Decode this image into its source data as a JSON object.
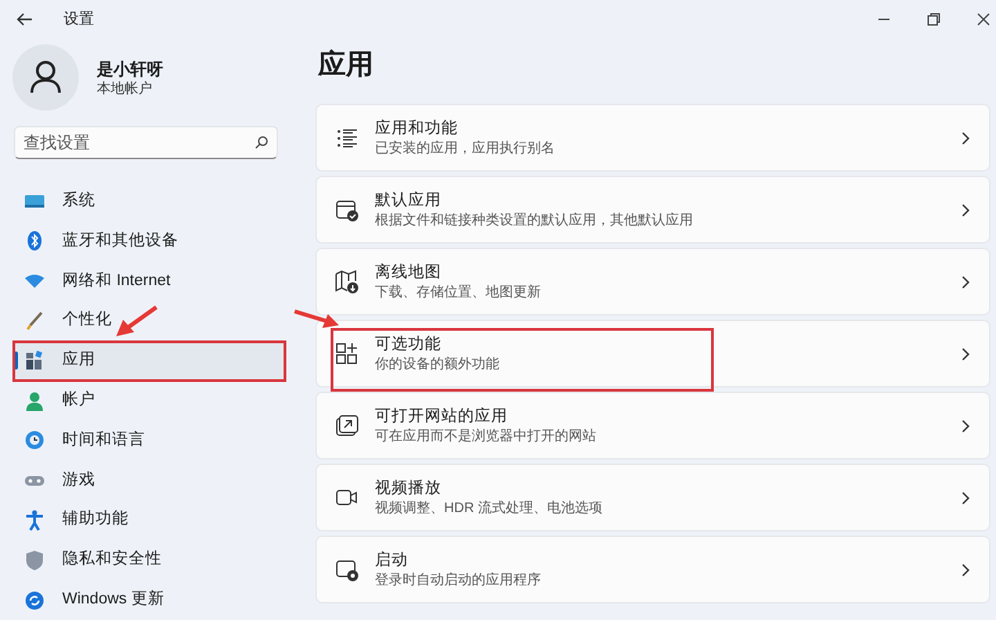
{
  "window": {
    "title": "设置"
  },
  "profile": {
    "name": "是小轩呀",
    "account_type": "本地帐户"
  },
  "search": {
    "placeholder": "查找设置"
  },
  "sidebar": {
    "items": [
      {
        "label": "系统",
        "selected": false,
        "annotated": false
      },
      {
        "label": "蓝牙和其他设备",
        "selected": false,
        "annotated": false
      },
      {
        "label": "网络和 Internet",
        "selected": false,
        "annotated": false
      },
      {
        "label": "个性化",
        "selected": false,
        "annotated": false
      },
      {
        "label": "应用",
        "selected": true,
        "annotated": true
      },
      {
        "label": "帐户",
        "selected": false,
        "annotated": false
      },
      {
        "label": "时间和语言",
        "selected": false,
        "annotated": false
      },
      {
        "label": "游戏",
        "selected": false,
        "annotated": false
      },
      {
        "label": "辅助功能",
        "selected": false,
        "annotated": false
      },
      {
        "label": "隐私和安全性",
        "selected": false,
        "annotated": false
      },
      {
        "label": "Windows 更新",
        "selected": false,
        "annotated": false
      }
    ]
  },
  "page": {
    "title": "应用",
    "cards": [
      {
        "title": "应用和功能",
        "subtitle": "已安装的应用，应用执行别名",
        "annotated": false
      },
      {
        "title": "默认应用",
        "subtitle": "根据文件和链接种类设置的默认应用，其他默认应用",
        "annotated": false
      },
      {
        "title": "离线地图",
        "subtitle": "下载、存储位置、地图更新",
        "annotated": false
      },
      {
        "title": "可选功能",
        "subtitle": "你的设备的额外功能",
        "annotated": true
      },
      {
        "title": "可打开网站的应用",
        "subtitle": "可在应用而不是浏览器中打开的网站",
        "annotated": false
      },
      {
        "title": "视频播放",
        "subtitle": "视频调整、HDR 流式处理、电池选项",
        "annotated": false
      },
      {
        "title": "启动",
        "subtitle": "登录时自动启动的应用程序",
        "annotated": false
      }
    ]
  }
}
